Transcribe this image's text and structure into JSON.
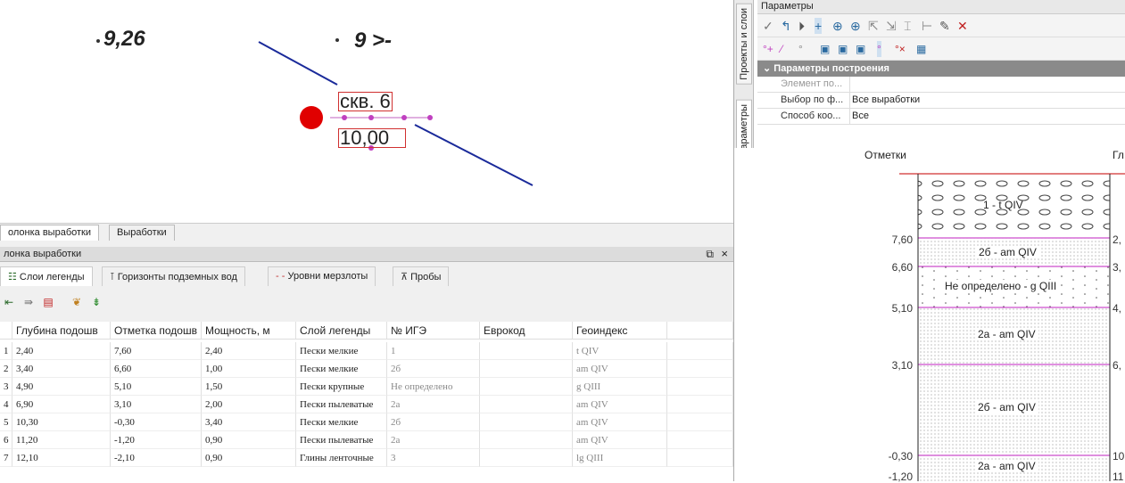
{
  "canvas": {
    "n1": "9,26",
    "n2": "9 >-",
    "label_top": "скв. 6",
    "label_bottom": "10,00"
  },
  "bottom": {
    "tab1": "олонка выработки",
    "tab2": "Выработки",
    "panel_title": "лонка выработки",
    "subtabs": [
      "Слои легенды",
      "Горизонты подземных вод",
      "Уровни мерзлоты",
      "Пробы"
    ],
    "columns": [
      "Глубина подошв",
      "Отметка подошв",
      "Мощность, м",
      "Слой легенды",
      "№ ИГЭ",
      "Еврокод",
      "Геоиндекс"
    ],
    "rows": [
      {
        "n": "1",
        "c": [
          "2,40",
          "7,60",
          "2,40",
          "Пески мелкие",
          "1",
          "",
          "t QIV"
        ]
      },
      {
        "n": "2",
        "c": [
          "3,40",
          "6,60",
          "1,00",
          "Пески мелкие",
          "2б",
          "",
          "am QIV"
        ]
      },
      {
        "n": "3",
        "c": [
          "4,90",
          "5,10",
          "1,50",
          "Пески крупные",
          "Не определено",
          "",
          "g QIII"
        ]
      },
      {
        "n": "4",
        "c": [
          "6,90",
          "3,10",
          "2,00",
          "Пески пылеватые",
          "2а",
          "",
          "am QIV"
        ]
      },
      {
        "n": "5",
        "c": [
          "10,30",
          "-0,30",
          "3,40",
          "Пески мелкие",
          "2б",
          "",
          "am QIV"
        ]
      },
      {
        "n": "6",
        "c": [
          "11,20",
          "-1,20",
          "0,90",
          "Пески пылеватые",
          "2а",
          "",
          "am QIV"
        ]
      },
      {
        "n": "7",
        "c": [
          "12,10",
          "-2,10",
          "0,90",
          "Глины ленточные",
          "3",
          "",
          "lg QIII"
        ]
      }
    ]
  },
  "right": {
    "vtab1": "Проекты и слои",
    "vtab2": "Параметры",
    "title": "Параметры",
    "section": "Параметры построения",
    "props": [
      {
        "k": "Элемент по...",
        "v": ""
      },
      {
        "k": "Выбор по ф...",
        "v": "Все выработки"
      },
      {
        "k": "Способ коо...",
        "v": "Все"
      }
    ],
    "col_header": "Отметки",
    "col_header2": "Гл",
    "marks": [
      "7,60",
      "6,60",
      "5,10",
      "3,10",
      "-0,30",
      "-1,20"
    ],
    "rmarks": [
      "2,",
      "3,",
      "4,",
      "6,",
      "10",
      "11"
    ],
    "layers": [
      "1 - t QIV",
      "2б - am QIV",
      "Не определено - g QIII",
      "2а - am QIV",
      "2б - am QIV",
      "2а - am QIV"
    ]
  }
}
